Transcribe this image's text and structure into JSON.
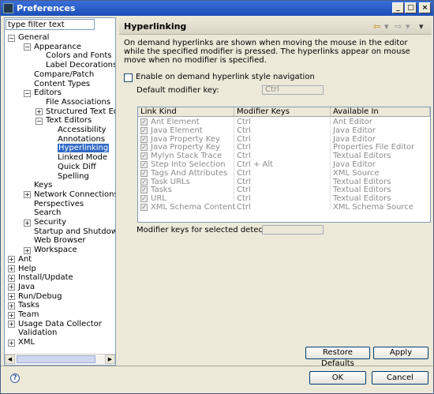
{
  "window": {
    "title": "Preferences"
  },
  "filter": {
    "value": "type filter text"
  },
  "tree": [
    {
      "label": "General",
      "expander": "−"
    },
    {
      "label": "Appearance",
      "expander": "−"
    },
    {
      "label": "Colors and Fonts",
      "expander": ""
    },
    {
      "label": "Label Decorations",
      "expander": ""
    },
    {
      "label": "Compare/Patch",
      "expander": ""
    },
    {
      "label": "Content Types",
      "expander": ""
    },
    {
      "label": "Editors",
      "expander": "−"
    },
    {
      "label": "File Associations",
      "expander": ""
    },
    {
      "label": "Structured Text Edit",
      "expander": "+"
    },
    {
      "label": "Text Editors",
      "expander": "−"
    },
    {
      "label": "Accessibility",
      "expander": ""
    },
    {
      "label": "Annotations",
      "expander": ""
    },
    {
      "label": "Hyperlinking",
      "expander": ""
    },
    {
      "label": "Linked Mode",
      "expander": ""
    },
    {
      "label": "Quick Diff",
      "expander": ""
    },
    {
      "label": "Spelling",
      "expander": ""
    },
    {
      "label": "Keys",
      "expander": ""
    },
    {
      "label": "Network Connections",
      "expander": "+"
    },
    {
      "label": "Perspectives",
      "expander": ""
    },
    {
      "label": "Search",
      "expander": ""
    },
    {
      "label": "Security",
      "expander": "+"
    },
    {
      "label": "Startup and Shutdown",
      "expander": ""
    },
    {
      "label": "Web Browser",
      "expander": ""
    },
    {
      "label": "Workspace",
      "expander": "+"
    },
    {
      "label": "Ant",
      "expander": "+"
    },
    {
      "label": "Help",
      "expander": "+"
    },
    {
      "label": "Install/Update",
      "expander": "+"
    },
    {
      "label": "Java",
      "expander": "+"
    },
    {
      "label": "Run/Debug",
      "expander": "+"
    },
    {
      "label": "Tasks",
      "expander": "+"
    },
    {
      "label": "Team",
      "expander": "+"
    },
    {
      "label": "Usage Data Collector",
      "expander": "+"
    },
    {
      "label": "Validation",
      "expander": ""
    },
    {
      "label": "XML",
      "expander": "+"
    }
  ],
  "selected_node": "Hyperlinking",
  "page": {
    "title": "Hyperlinking",
    "description": "On demand hyperlinks are shown when moving the mouse in the editor while the specified modifier is pressed. The hyperlinks appear on mouse move when no modifier is specified.",
    "enable_label": "Enable on demand hyperlink style navigation",
    "enable_checked": false,
    "default_modifier_label": "Default modifier key:",
    "default_modifier_value": "Ctrl",
    "columns": [
      "Link Kind",
      "Modifier Keys",
      "Available In"
    ],
    "rows": [
      {
        "kind": "Ant Element",
        "keys": "Ctrl",
        "available": "Ant Editor"
      },
      {
        "kind": "Java Element",
        "keys": "Ctrl",
        "available": "Java Editor"
      },
      {
        "kind": "Java Property Key",
        "keys": "Ctrl",
        "available": "Java Editor"
      },
      {
        "kind": "Java Property Key",
        "keys": "Ctrl",
        "available": "Properties File Editor"
      },
      {
        "kind": "Mylyn Stack Trace",
        "keys": "Ctrl",
        "available": "Textual Editors"
      },
      {
        "kind": "Step Into Selection",
        "keys": "Ctrl + Alt",
        "available": "Java Editor"
      },
      {
        "kind": "Tags And Attributes",
        "keys": "Ctrl",
        "available": "XML Source"
      },
      {
        "kind": "Task URLs",
        "keys": "Ctrl",
        "available": "Textual Editors"
      },
      {
        "kind": "Tasks",
        "keys": "Ctrl",
        "available": "Textual Editors"
      },
      {
        "kind": "URL",
        "keys": "Ctrl",
        "available": "Textual Editors"
      },
      {
        "kind": "XML Schema Content",
        "keys": "Ctrl",
        "available": "XML Schema Source"
      }
    ],
    "modifier_selected_label": "Modifier keys for selected detector:",
    "modifier_selected_value": "",
    "restore_label": "Restore Defaults",
    "apply_label": "Apply"
  },
  "footer": {
    "help_glyph": "?",
    "ok_label": "OK",
    "cancel_label": "Cancel"
  },
  "titlebar_buttons": {
    "minimize": "_",
    "maximize": "□",
    "close": "×"
  },
  "nav_glyphs": {
    "back": "⇦",
    "forward": "⇨",
    "menu": "▾"
  },
  "colors": {
    "titlebar": "#1c4fb8",
    "selection": "#316ac5",
    "disabled_text": "#8c8c8c",
    "dialog_bg": "#ece9d8"
  },
  "icons": {
    "help": "help-icon",
    "back": "back-arrow-icon",
    "forward": "forward-arrow-icon",
    "menu": "view-menu-icon",
    "window": "preferences-window-icon"
  }
}
